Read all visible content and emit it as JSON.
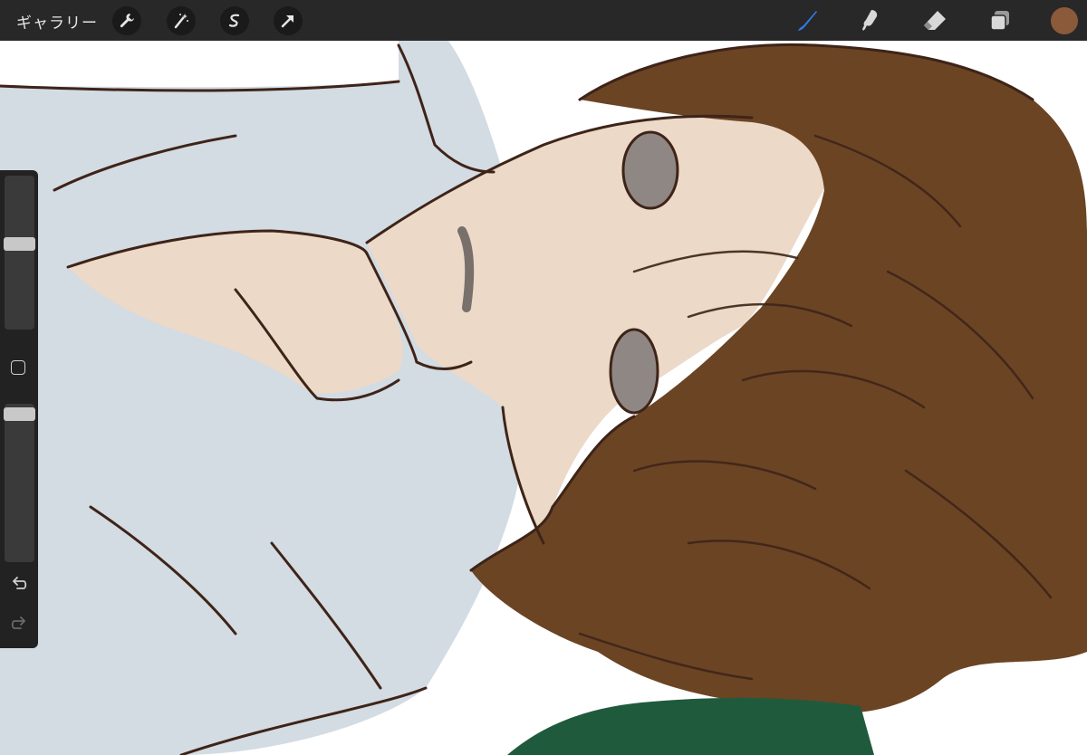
{
  "toolbar": {
    "gallery_label": "ギャラリー",
    "left_tools": [
      "wrench-icon",
      "magic-wand-icon",
      "selection-icon",
      "transform-arrow-icon"
    ],
    "right_tools": [
      "brush-icon",
      "smudge-icon",
      "eraser-icon",
      "layers-icon"
    ],
    "active_tool": "brush-icon",
    "current_color": "#8a5a3a"
  },
  "sidebar": {
    "brush_size_level": 0.45,
    "opacity_level": 0.05,
    "buttons": [
      "modify-button",
      "undo-icon",
      "redo-icon"
    ]
  },
  "colors": {
    "accent": "#2f7be8",
    "hair": "#6b4424",
    "skin": "#ecd9c8",
    "shirt": "#d3dbe3",
    "line": "#3e2418",
    "green": "#1f5a3c"
  }
}
